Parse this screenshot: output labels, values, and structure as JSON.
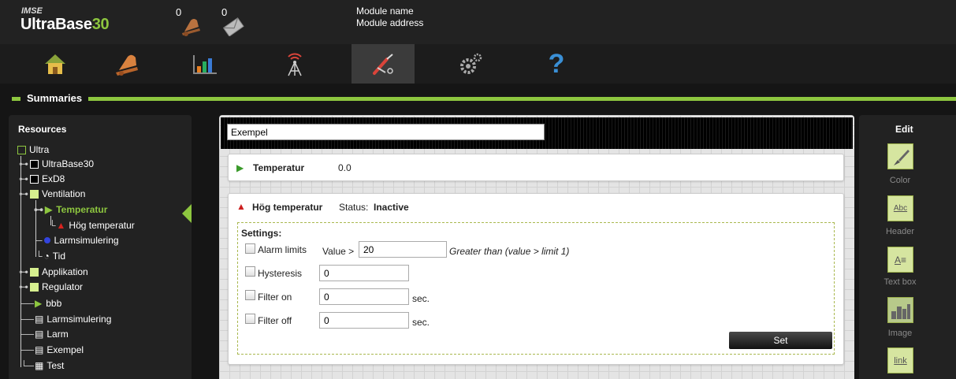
{
  "header": {
    "brand_small": "IMSE",
    "brand_main": "UltraBase",
    "brand_num": "30",
    "alarm_count": "0",
    "message_count": "0",
    "module_name": "Module name",
    "module_address": "Module address"
  },
  "toolbar": {
    "items": [
      {
        "icon": "home-icon"
      },
      {
        "icon": "alarm-bell-icon"
      },
      {
        "icon": "chart-icon"
      },
      {
        "icon": "antenna-icon"
      },
      {
        "icon": "tools-icon",
        "active": true
      },
      {
        "icon": "gears-icon"
      },
      {
        "icon": "help-icon",
        "glyph": "?"
      }
    ]
  },
  "section": {
    "title": "Summaries"
  },
  "resources": {
    "title": "Resources",
    "tree": [
      {
        "label": "Ultra"
      },
      {
        "label": "UltraBase30"
      },
      {
        "label": "ExD8"
      },
      {
        "label": "Ventilation"
      },
      {
        "label": "Temperatur",
        "selected": true
      },
      {
        "label": "Hög temperatur"
      },
      {
        "label": "Larmsimulering"
      },
      {
        "label": "Tid"
      },
      {
        "label": "Applikation"
      },
      {
        "label": "Regulator"
      },
      {
        "label": "bbb"
      },
      {
        "label": "Larmsimulering"
      },
      {
        "label": "Larm"
      },
      {
        "label": "Exempel"
      },
      {
        "label": "Test"
      }
    ]
  },
  "main": {
    "title_value": "Exempel",
    "temp_card": {
      "name": "Temperatur",
      "value": "0.0"
    },
    "alarm_card": {
      "name": "Hög temperatur",
      "status_label": "Status:",
      "status_value": "Inactive",
      "settings_label": "Settings:",
      "alarm_limits": {
        "label": "Alarm limits",
        "prefix": "Value >",
        "value": "20",
        "hint": "Greater than (value > limit 1)"
      },
      "hysteresis": {
        "label": "Hysteresis",
        "value": "0"
      },
      "filter_on": {
        "label": "Filter on",
        "value": "0",
        "unit": "sec."
      },
      "filter_off": {
        "label": "Filter off",
        "value": "0",
        "unit": "sec."
      },
      "set_button": "Set"
    }
  },
  "edit": {
    "title": "Edit",
    "tools": [
      {
        "label": "Color",
        "icon": "brush-icon"
      },
      {
        "label": "Header",
        "icon": "header-icon",
        "glyph": "Abc"
      },
      {
        "label": "Text box",
        "icon": "textbox-icon",
        "glyph": "A"
      },
      {
        "label": "Image",
        "icon": "image-icon"
      },
      {
        "label": "",
        "icon": "link-icon",
        "glyph": "link"
      }
    ]
  },
  "colors": {
    "accent": "#8dc63f",
    "alarm_red": "#cc1f1f",
    "background": "#151515"
  }
}
